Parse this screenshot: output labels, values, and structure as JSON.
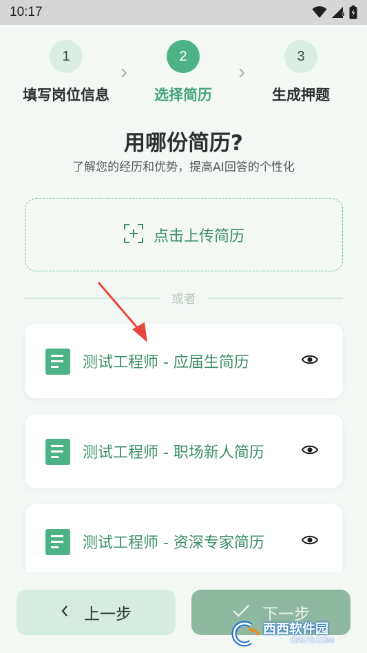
{
  "status_bar": {
    "time": "10:17",
    "icons": [
      "wifi-icon",
      "signal-icon",
      "battery-charging-icon"
    ]
  },
  "stepper": {
    "steps": [
      {
        "number": "1",
        "label": "填写岗位信息",
        "state": "done"
      },
      {
        "number": "2",
        "label": "选择简历",
        "state": "active"
      },
      {
        "number": "3",
        "label": "生成押题",
        "state": "pending"
      }
    ]
  },
  "page": {
    "title": "用哪份简历?",
    "subtitle": "了解您的经历和优势，提高AI回答的个性化"
  },
  "upload": {
    "label": "点击上传简历",
    "icon": "upload-plus-icon"
  },
  "divider": {
    "text": "或者"
  },
  "resumes": [
    {
      "title": "测试工程师 - 应届生简历",
      "icon": "document-icon",
      "action_icon": "eye-icon"
    },
    {
      "title": "测试工程师 - 职场新人简历",
      "icon": "document-icon",
      "action_icon": "eye-icon"
    },
    {
      "title": "测试工程师 - 资深专家简历",
      "icon": "document-icon",
      "action_icon": "eye-icon"
    }
  ],
  "footer": {
    "prev_label": "上一步",
    "next_label": "下一步"
  },
  "watermark": {
    "title": "西西软件园",
    "subtitle": "CR173.COM"
  },
  "colors": {
    "accent": "#4db386",
    "accent_text": "#3d8c67",
    "background": "#f3f8f5",
    "step_inactive": "#dbeee3",
    "annotation_arrow": "#e8453c"
  }
}
